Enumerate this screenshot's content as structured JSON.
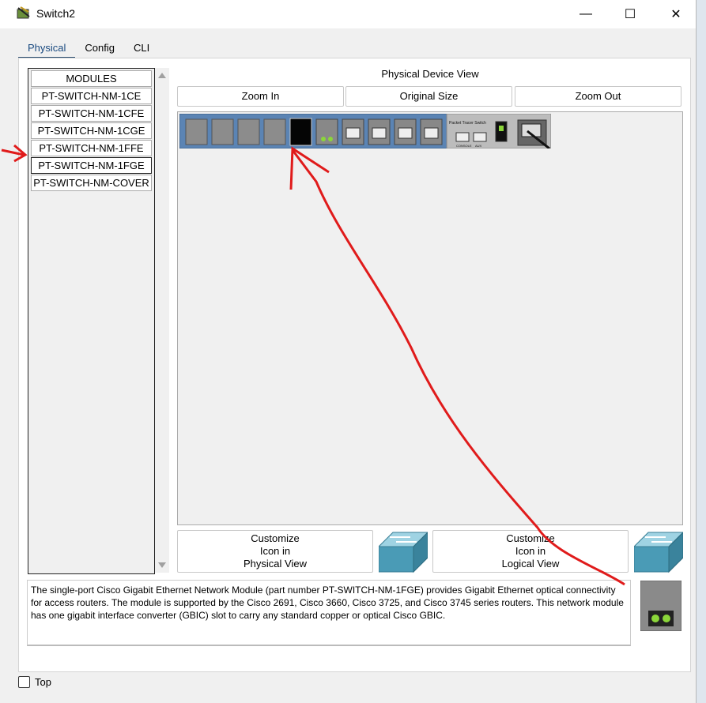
{
  "window": {
    "title": "Switch2",
    "minimize": "—",
    "maximize": "☐",
    "close": "✕"
  },
  "tabs": [
    {
      "label": "Physical",
      "active": true
    },
    {
      "label": "Config"
    },
    {
      "label": "CLI"
    }
  ],
  "modules": {
    "header": "MODULES",
    "items": [
      "PT-SWITCH-NM-1CE",
      "PT-SWITCH-NM-1CFE",
      "PT-SWITCH-NM-1CGE",
      "PT-SWITCH-NM-1FFE",
      "PT-SWITCH-NM-1FGE",
      "PT-SWITCH-NM-COVER"
    ],
    "selected": "PT-SWITCH-NM-1FGE"
  },
  "physical_view": {
    "title": "Physical Device View",
    "zoom_in": "Zoom In",
    "original_size": "Original Size",
    "zoom_out": "Zoom Out",
    "device_brand": "Packet Tracer Switch",
    "console_label": "CONSOLE",
    "aux_label": "AUX"
  },
  "customize": {
    "physical": [
      "Customize",
      "Icon in",
      "Physical View"
    ],
    "logical": [
      "Customize",
      "Icon in",
      "Logical View"
    ]
  },
  "description": "The single-port Cisco Gigabit Ethernet Network Module (part number PT-SWITCH-NM-1FGE) provides Gigabit Ethernet optical connectivity for access routers. The module is supported by the Cisco 2691, Cisco 3660, Cisco 3725, and Cisco 3745 series routers. This network module has one gigabit interface converter (GBIC) slot to carry any standard copper or optical Cisco GBIC.",
  "footer": {
    "top_label": "Top",
    "top_checked": false
  },
  "colors": {
    "accent": "#2d4f70",
    "annotation": "#e01b1b",
    "device_blue": "#5b84b4"
  }
}
